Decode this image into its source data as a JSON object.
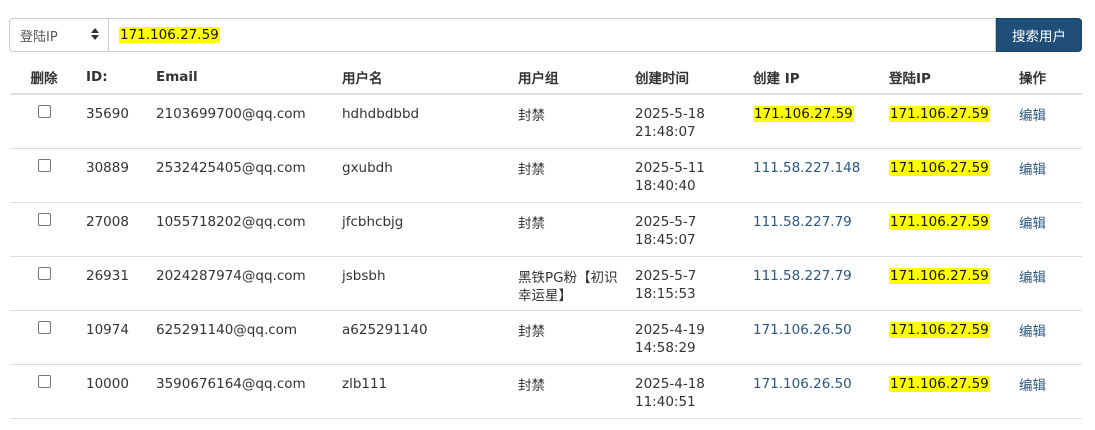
{
  "search": {
    "select_value": "登陆IP",
    "query": "171.106.27.59",
    "button_label": "搜索用户"
  },
  "table": {
    "headers": [
      "删除",
      "ID:",
      "Email",
      "用户名",
      "用户组",
      "创建时间",
      "创建 IP",
      "登陆IP",
      "操作"
    ],
    "rows": [
      {
        "id": "35690",
        "email": "2103699700@qq.com",
        "username": "hdhdbdbbd",
        "group": "封禁",
        "created_date": "2025-5-18",
        "created_time": "21:48:07",
        "create_ip": "171.106.27.59",
        "create_ip_highlight": true,
        "login_ip": "171.106.27.59",
        "action": "编辑"
      },
      {
        "id": "30889",
        "email": "2532425405@qq.com",
        "username": "gxubdh",
        "group": "封禁",
        "created_date": "2025-5-11",
        "created_time": "18:40:40",
        "create_ip": "111.58.227.148",
        "create_ip_highlight": false,
        "login_ip": "171.106.27.59",
        "action": "编辑"
      },
      {
        "id": "27008",
        "email": "1055718202@qq.com",
        "username": "jfcbhcbjg",
        "group": "封禁",
        "created_date": "2025-5-7",
        "created_time": "18:45:07",
        "create_ip": "111.58.227.79",
        "create_ip_highlight": false,
        "login_ip": "171.106.27.59",
        "action": "编辑"
      },
      {
        "id": "26931",
        "email": "2024287974@qq.com",
        "username": "jsbsbh",
        "group": "黑铁PG粉【初识幸运星】",
        "created_date": "2025-5-7",
        "created_time": "18:15:53",
        "create_ip": "111.58.227.79",
        "create_ip_highlight": false,
        "login_ip": "171.106.27.59",
        "action": "编辑"
      },
      {
        "id": "10974",
        "email": "625291140@qq.com",
        "username": "a625291140",
        "group": "封禁",
        "created_date": "2025-4-19",
        "created_time": "14:58:29",
        "create_ip": "171.106.26.50",
        "create_ip_highlight": false,
        "login_ip": "171.106.27.59",
        "action": "编辑"
      },
      {
        "id": "10000",
        "email": "3590676164@qq.com",
        "username": "zlb111",
        "group": "封禁",
        "created_date": "2025-4-18",
        "created_time": "11:40:51",
        "create_ip": "171.106.26.50",
        "create_ip_highlight": false,
        "login_ip": "171.106.27.59",
        "action": "编辑"
      }
    ]
  },
  "colors": {
    "highlight": "#ffff00",
    "link": "#2a5783",
    "button": "#1f4e79"
  }
}
